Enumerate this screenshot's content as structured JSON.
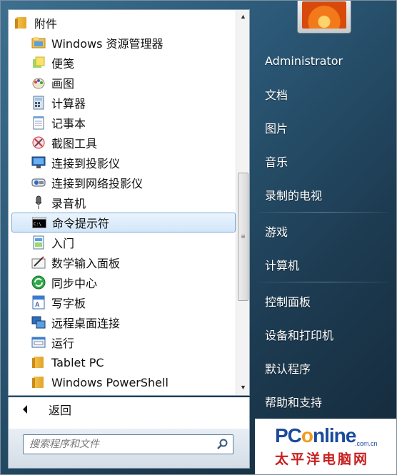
{
  "programs": {
    "folder_label": "附件",
    "items": [
      {
        "label": "Windows 资源管理器",
        "icon": "explorer-icon"
      },
      {
        "label": "便笺",
        "icon": "sticky-notes-icon"
      },
      {
        "label": "画图",
        "icon": "paint-icon"
      },
      {
        "label": "计算器",
        "icon": "calculator-icon"
      },
      {
        "label": "记事本",
        "icon": "notepad-icon"
      },
      {
        "label": "截图工具",
        "icon": "snipping-tool-icon"
      },
      {
        "label": "连接到投影仪",
        "icon": "projector-icon"
      },
      {
        "label": "连接到网络投影仪",
        "icon": "network-projector-icon"
      },
      {
        "label": "录音机",
        "icon": "sound-recorder-icon"
      },
      {
        "label": "命令提示符",
        "icon": "command-prompt-icon"
      },
      {
        "label": "入门",
        "icon": "getting-started-icon"
      },
      {
        "label": "数学输入面板",
        "icon": "math-input-icon"
      },
      {
        "label": "同步中心",
        "icon": "sync-center-icon"
      },
      {
        "label": "写字板",
        "icon": "wordpad-icon"
      },
      {
        "label": "远程桌面连接",
        "icon": "remote-desktop-icon"
      },
      {
        "label": "运行",
        "icon": "run-icon"
      }
    ],
    "subfolders": [
      {
        "label": "Tablet PC",
        "icon": "folder-icon"
      },
      {
        "label": "Windows PowerShell",
        "icon": "folder-icon"
      }
    ],
    "selected_label": "命令提示符"
  },
  "back": {
    "label": "返回"
  },
  "search": {
    "placeholder": "搜索程序和文件"
  },
  "right_panel": {
    "items": [
      "Administrator",
      "文档",
      "图片",
      "音乐",
      "录制的电视",
      "游戏",
      "计算机",
      "控制面板",
      "设备和打印机",
      "默认程序",
      "帮助和支持"
    ]
  },
  "watermark": {
    "brand_pre": "PC",
    "brand_o": "o",
    "brand_post": "nline",
    "domain": ".com.cn",
    "cn_name": "太平洋电脑网"
  },
  "colors": {
    "selection_border": "#7fa9d4",
    "menu_bg": "#2b5876",
    "watermark_blue": "#1a4a9c",
    "watermark_red": "#c81f1f",
    "watermark_orange": "#f19b1c"
  }
}
